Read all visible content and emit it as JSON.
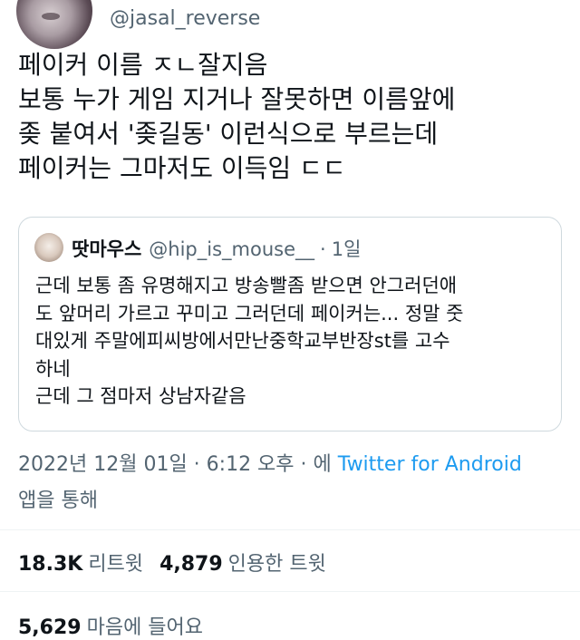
{
  "author": {
    "handle": "@jasal_reverse"
  },
  "tweet": {
    "text": "페이커 이름 ㅈㄴ잘지음\n보통 누가 게임 지거나 잘못하면 이름앞에\n좆 붙여서 '좆길동' 이런식으로 부르는데\n페이커는 그마저도 이득임 ㄷㄷ"
  },
  "quote": {
    "name": "땃마우스",
    "handle": "@hip_is_mouse__",
    "separator": "·",
    "time": "1일",
    "text": "근데 보통 좀 유명해지고 방송빨좀 받으면 안그러던애\n도 앞머리 가르고 꾸미고 그러던데 페이커는... 정말 줏\n대있게 주말에피씨방에서만난중학교부반장st를 고수\n하네\n근데 그 점마저 상남자같음"
  },
  "meta": {
    "timestamp": "2022년 12월 01일 · 6:12 오후 · 에",
    "source": "Twitter for Android",
    "suffix": "앱을 통해"
  },
  "stats": {
    "retweets_count": "18.3K",
    "retweets_label": "리트윗",
    "quotes_count": "4,879",
    "quotes_label": "인용한 트윗",
    "likes_count": "5,629",
    "likes_label": "마음에 들어요"
  }
}
